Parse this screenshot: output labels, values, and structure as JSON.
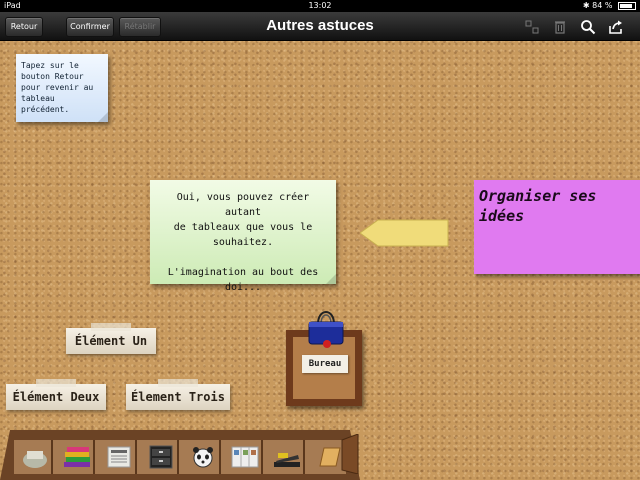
{
  "status_bar": {
    "device": "iPad",
    "time": "13:02",
    "battery": "84 %",
    "battery_level": 0.84
  },
  "toolbar": {
    "back_label": "Retour",
    "confirm_label": "Confirmer",
    "redo_label": "Rétablir",
    "title": "Autres astuces",
    "icons": [
      "arrange-icon",
      "trash-icon",
      "search-icon",
      "share-icon"
    ]
  },
  "notes": {
    "blue": {
      "lines": [
        "Tapez sur le",
        "bouton Retour",
        "pour revenir au",
        "tableau précédent."
      ],
      "color": "#cfe1f7"
    },
    "green": {
      "lines": [
        "Oui, vous pouvez créer autant",
        "de tableaux que vous le",
        "souhaitez."
      ],
      "extra": "L'imagination au bout des doi...",
      "color": "#cdebb5"
    },
    "purple": {
      "text": "Organiser ses idées",
      "color": "#e07af0"
    }
  },
  "labels": {
    "element_un": "Élément Un",
    "element_deux": "Élément Deux",
    "element_trois": "Élement Trois"
  },
  "board": {
    "bureau_label": "Bureau"
  },
  "shelf": {
    "items": [
      "eraser-icon",
      "books-icon",
      "newspaper-icon",
      "file-cabinet-icon",
      "panda-icon",
      "brochure-icon",
      "stapler-icon",
      "notepad-icon"
    ]
  }
}
